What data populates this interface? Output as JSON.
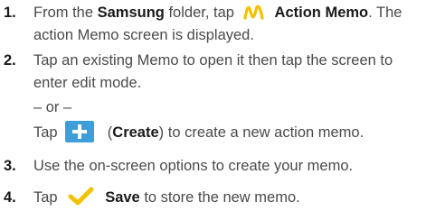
{
  "steps": [
    {
      "number": "1.",
      "line1_before": "From the ",
      "folder_name": "Samsung",
      "line1_middle": " folder, tap ",
      "icon": "action-memo-icon",
      "app_name": "Action Memo",
      "line1_after": ". The",
      "line2": "action Memo screen is displayed."
    },
    {
      "number": "2.",
      "line1": "Tap an existing Memo to open it then tap the screen to",
      "line2": "enter edit mode.",
      "or_text": "– or –",
      "alt_before": "Tap ",
      "alt_icon": "create-plus-icon",
      "alt_paren_open": " (",
      "alt_action": "Create",
      "alt_after": ") to create a new action memo."
    },
    {
      "number": "3.",
      "line1": "Use the on-screen options to create your memo."
    },
    {
      "number": "4.",
      "before": "Tap ",
      "icon": "save-check-icon",
      "action": "Save",
      "after": " to store the new memo."
    }
  ],
  "colors": {
    "text": "#4a4a4a",
    "memo_icon": "#f2c200",
    "create_icon": "#3f9ed8",
    "save_icon": "#f2c200"
  }
}
